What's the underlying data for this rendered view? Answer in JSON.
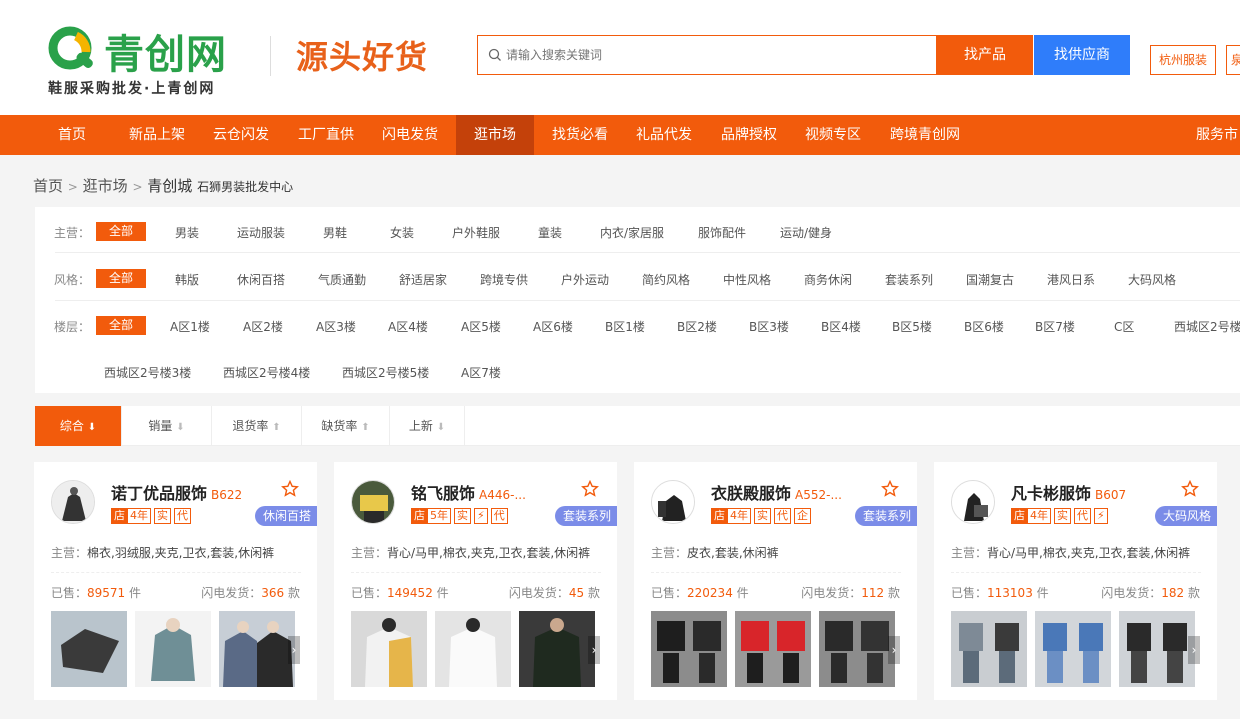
{
  "header": {
    "logo_text": "青创网",
    "slogan": "鞋服采购批发·上青创网",
    "promo": "源头好货",
    "search_placeholder": "请输入搜索关键词",
    "find_product": "找产品",
    "find_supplier": "找供应商",
    "city1": "杭州服装",
    "city2": "泉",
    "brand_green": "#2aa14a",
    "accent": "#f25b0c"
  },
  "nav": {
    "items": [
      "首页",
      "新品上架",
      "云仓闪发",
      "工厂直供",
      "闪电发货",
      "逛市场",
      "找货必看",
      "礼品代发",
      "品牌授权",
      "视频专区",
      "跨境青创网"
    ],
    "right": "服务市",
    "active_index": 5
  },
  "breadcrumb": {
    "home": "首页",
    "market": "逛市场",
    "current": "青创城",
    "sub": "石狮男装批发中心",
    "sep": ">"
  },
  "filters": {
    "main_label": "主营：",
    "main": [
      "全部",
      "男装",
      "运动服装",
      "男鞋",
      "女装",
      "户外鞋服",
      "童装",
      "内衣/家居服",
      "服饰配件",
      "运动/健身"
    ],
    "style_label": "风格：",
    "style": [
      "全部",
      "韩版",
      "休闲百搭",
      "气质通勤",
      "舒适居家",
      "跨境专供",
      "户外运动",
      "简约风格",
      "中性风格",
      "商务休闲",
      "套装系列",
      "国潮复古",
      "港风日系",
      "大码风格"
    ],
    "floor_label": "楼层：",
    "floor": [
      "全部",
      "A区1楼",
      "A区2楼",
      "A区3楼",
      "A区4楼",
      "A区5楼",
      "A区6楼",
      "B区1楼",
      "B区2楼",
      "B区3楼",
      "B区4楼",
      "B区5楼",
      "B区6楼",
      "B区7楼",
      "C区",
      "西城区2号楼",
      "西城区2号楼3楼",
      "西城区2号楼4楼",
      "西城区2号楼5楼",
      "A区7楼"
    ]
  },
  "sort": {
    "items": [
      "综合",
      "销量",
      "退货率",
      "缺货率",
      "上新"
    ],
    "arrows": [
      "⬇",
      "⬇",
      "⬆",
      "⬆",
      "⬇"
    ]
  },
  "shops": [
    {
      "name": "诺丁优品服饰",
      "loc": "B622",
      "shop_badge": "店",
      "years": "4年",
      "badges": [
        "实",
        "代"
      ],
      "style": "休闲百搭",
      "main_label": "主营：",
      "main": "棉衣,羽绒服,夹克,卫衣,套装,休闲裤",
      "sold_label": "已售：",
      "sold": "89571",
      "unit": "件",
      "flash_label": "闪电发货：",
      "flash": "366",
      "flash_unit": "款"
    },
    {
      "name": "铭飞服饰",
      "loc": "A446-...",
      "shop_badge": "店",
      "years": "5年",
      "badges": [
        "实",
        "⚡",
        "代"
      ],
      "style": "套装系列",
      "main_label": "主营：",
      "main": "背心/马甲,棉衣,夹克,卫衣,套装,休闲裤",
      "sold_label": "已售：",
      "sold": "149452",
      "unit": "件",
      "flash_label": "闪电发货：",
      "flash": "45",
      "flash_unit": "款"
    },
    {
      "name": "衣朕殿服饰",
      "loc": "A552-...",
      "shop_badge": "店",
      "years": "4年",
      "badges": [
        "实",
        "代",
        "企"
      ],
      "style": "套装系列",
      "main_label": "主营：",
      "main": "皮衣,套装,休闲裤",
      "sold_label": "已售：",
      "sold": "220234",
      "unit": "件",
      "flash_label": "闪电发货：",
      "flash": "112",
      "flash_unit": "款"
    },
    {
      "name": "凡卡彬服饰",
      "loc": "B607",
      "shop_badge": "店",
      "years": "4年",
      "badges": [
        "实",
        "代",
        "⚡"
      ],
      "style": "大码风格",
      "main_label": "主营：",
      "main": "背心/马甲,棉衣,夹克,卫衣,套装,休闲裤",
      "sold_label": "已售：",
      "sold": "113103",
      "unit": "件",
      "flash_label": "闪电发货：",
      "flash": "182",
      "flash_unit": "款"
    }
  ]
}
